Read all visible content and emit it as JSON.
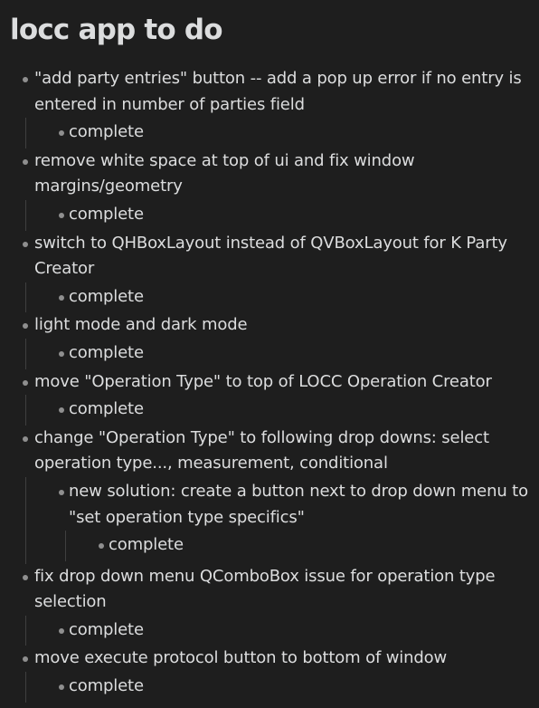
{
  "title": "locc app to do",
  "items": [
    {
      "text": "\"add party entries\" button -- add a pop up error if no entry is entered in number of parties field",
      "children": [
        {
          "text": "complete",
          "children": []
        }
      ]
    },
    {
      "text": "remove white space at top of ui and fix window margins/geometry",
      "children": [
        {
          "text": "complete",
          "children": []
        }
      ]
    },
    {
      "text": "switch to QHBoxLayout instead of QVBoxLayout for K Party Creator",
      "children": [
        {
          "text": "complete",
          "children": []
        }
      ]
    },
    {
      "text": "light mode and dark mode",
      "children": [
        {
          "text": "complete",
          "children": []
        }
      ]
    },
    {
      "text": "move \"Operation Type\" to top of LOCC Operation Creator",
      "children": [
        {
          "text": "complete",
          "children": []
        }
      ]
    },
    {
      "text": "change \"Operation Type\"  to following drop downs: select operation type..., measurement, conditional",
      "children": [
        {
          "text": "new solution: create a button next to drop down menu to \"set operation type specifics\"",
          "children": [
            {
              "text": "complete",
              "children": []
            }
          ]
        }
      ]
    },
    {
      "text": "fix drop down menu QComboBox issue for operation type selection",
      "children": [
        {
          "text": "complete",
          "children": []
        }
      ]
    },
    {
      "text": "move execute protocol button to bottom of window",
      "children": [
        {
          "text": "complete",
          "children": []
        }
      ]
    }
  ]
}
